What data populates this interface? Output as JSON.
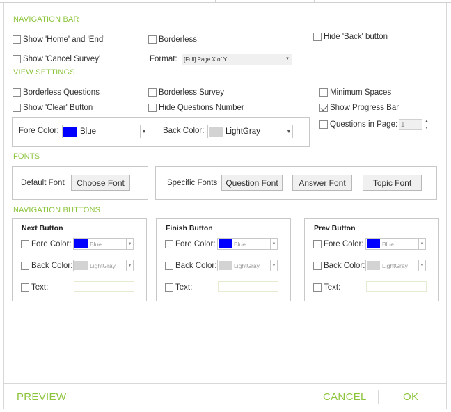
{
  "sections": {
    "navigation_bar": "NAVIGATION BAR",
    "view_settings": "VIEW SETTINGS",
    "fonts": "FONTS",
    "navigation_buttons": "NAVIGATION BUTTONS"
  },
  "navbar": {
    "show_home_end": "Show 'Home' and 'End'",
    "borderless": "Borderless",
    "hide_back": "Hide 'Back' button",
    "show_cancel": "Show 'Cancel Survey'",
    "format_label": "Format:",
    "format_value": "[Full] Page X of Y"
  },
  "view": {
    "borderless_questions": "Borderless Questions",
    "borderless_survey": "Borderless Survey",
    "minimum_spaces": "Minimum Spaces",
    "show_clear": "Show 'Clear' Button",
    "hide_questions_number": "Hide Questions Number",
    "show_progress_bar": "Show Progress Bar",
    "show_progress_bar_checked": true,
    "questions_in_page": "Questions in Page:",
    "questions_in_page_value": "1",
    "fore_color_label": "Fore Color:",
    "fore_color_value": "Blue",
    "fore_color_hex": "#0000ff",
    "back_color_label": "Back Color:",
    "back_color_value": "LightGray",
    "back_color_hex": "#d3d3d3"
  },
  "fonts": {
    "default_font": "Default Font",
    "choose_font": "Choose Font",
    "specific_fonts": "Specific Fonts",
    "question_font": "Question Font",
    "answer_font": "Answer Font",
    "topic_font": "Topic Font"
  },
  "nav_buttons": [
    {
      "title": "Next Button",
      "fore_label": "Fore Color:",
      "fore_value": "Blue",
      "fore_hex": "#0000ff",
      "back_label": "Back Color:",
      "back_value": "LightGray",
      "back_hex": "#d3d3d3",
      "text_label": "Text:",
      "text_value": ""
    },
    {
      "title": "Finish Button",
      "fore_label": "Fore Color:",
      "fore_value": "Blue",
      "fore_hex": "#0000ff",
      "back_label": "Back Color:",
      "back_value": "LightGray",
      "back_hex": "#d3d3d3",
      "text_label": "Text:",
      "text_value": ""
    },
    {
      "title": "Prev Button",
      "fore_label": "Fore Color:",
      "fore_value": "Blue",
      "fore_hex": "#0000ff",
      "back_label": "Back Color:",
      "back_value": "LightGray",
      "back_hex": "#d3d3d3",
      "text_label": "Text:",
      "text_value": ""
    }
  ],
  "footer": {
    "preview": "PREVIEW",
    "cancel": "CANCEL",
    "ok": "OK"
  },
  "colors": {
    "accent": "#8cc43c"
  }
}
